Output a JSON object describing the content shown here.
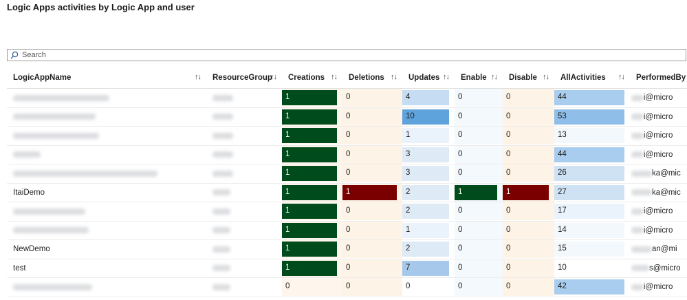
{
  "title": "Logic Apps activities by Logic App and user",
  "search": {
    "placeholder": "Search",
    "icon": "search-icon"
  },
  "columns": [
    {
      "label": "LogicAppName"
    },
    {
      "label": "ResourceGroup"
    },
    {
      "label": "Creations"
    },
    {
      "label": "Deletions"
    },
    {
      "label": "Updates"
    },
    {
      "label": "Enable"
    },
    {
      "label": "Disable"
    },
    {
      "label": "AllActivities"
    },
    {
      "label": "PerformedBy"
    }
  ],
  "sort_glyph": "↑↓",
  "colors": {
    "creations_bg": "#fef6ec",
    "creations_fill": "#004b1c",
    "deletions_bg": "#fdf3e6",
    "deletions_fill": "#7a0000",
    "updates_light": "#deeaf6",
    "updates_mid": "#a6c8ea",
    "updates_dark": "#5ea3dc",
    "enable_bg": "#f4f9fd",
    "enable_fill": "#004b1c",
    "disable_bg": "#fdf3e6",
    "disable_fill": "#7a0000",
    "all_light": "#eaf3fb",
    "all_mid": "#cfe2f4",
    "all_dark": "#8fbfe8"
  },
  "rows": [
    {
      "app": "",
      "creations": "1",
      "deletions": "0",
      "updates": "4",
      "enable": "0",
      "disable": "0",
      "all": "44",
      "by": "i@micro"
    },
    {
      "app": "",
      "creations": "1",
      "deletions": "0",
      "updates": "10",
      "enable": "0",
      "disable": "0",
      "all": "53",
      "by": "i@micro"
    },
    {
      "app": "",
      "creations": "1",
      "deletions": "0",
      "updates": "1",
      "enable": "0",
      "disable": "0",
      "all": "13",
      "by": "i@micro"
    },
    {
      "app": "",
      "creations": "1",
      "deletions": "0",
      "updates": "3",
      "enable": "0",
      "disable": "0",
      "all": "44",
      "by": "i@micro"
    },
    {
      "app": "",
      "creations": "1",
      "deletions": "0",
      "updates": "3",
      "enable": "0",
      "disable": "0",
      "all": "26",
      "by": "ka@mic"
    },
    {
      "app": "ItaiDemo",
      "creations": "1",
      "deletions": "1",
      "updates": "2",
      "enable": "1",
      "disable": "1",
      "all": "27",
      "by": "ka@mic"
    },
    {
      "app": "",
      "creations": "1",
      "deletions": "0",
      "updates": "2",
      "enable": "0",
      "disable": "0",
      "all": "17",
      "by": "i@micro"
    },
    {
      "app": "",
      "creations": "1",
      "deletions": "0",
      "updates": "1",
      "enable": "0",
      "disable": "0",
      "all": "14",
      "by": "i@micro"
    },
    {
      "app": "NewDemo",
      "creations": "1",
      "deletions": "0",
      "updates": "2",
      "enable": "0",
      "disable": "0",
      "all": "15",
      "by": "an@mi"
    },
    {
      "app": "test",
      "creations": "1",
      "deletions": "0",
      "updates": "7",
      "enable": "0",
      "disable": "0",
      "all": "10",
      "by": "s@micro"
    },
    {
      "app": "",
      "creations": "0",
      "deletions": "0",
      "updates": "0",
      "enable": "0",
      "disable": "0",
      "all": "42",
      "by": "i@micro"
    }
  ]
}
